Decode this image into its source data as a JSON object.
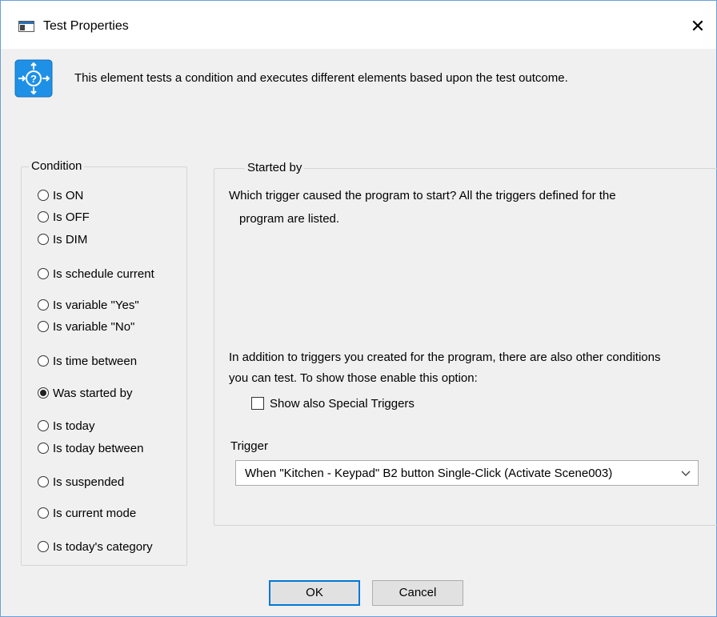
{
  "window": {
    "title": "Test Properties",
    "close_glyph": "✕"
  },
  "description": "This element tests a condition and executes different elements based upon the test outcome.",
  "condition": {
    "legend": "Condition",
    "options": [
      {
        "label": "Is ON",
        "checked": false
      },
      {
        "label": "Is OFF",
        "checked": false
      },
      {
        "label": "Is DIM",
        "checked": false
      },
      {
        "label": "Is schedule current",
        "checked": false
      },
      {
        "label": "Is variable \"Yes\"",
        "checked": false
      },
      {
        "label": "Is variable \"No\"",
        "checked": false
      },
      {
        "label": "Is time between",
        "checked": false
      },
      {
        "label": "Was started by",
        "checked": true
      },
      {
        "label": "Is today",
        "checked": false
      },
      {
        "label": "Is today between",
        "checked": false
      },
      {
        "label": "Is suspended",
        "checked": false
      },
      {
        "label": "Is current mode",
        "checked": false
      },
      {
        "label": "Is today's category",
        "checked": false
      }
    ]
  },
  "started_by": {
    "legend": "Started by",
    "question_line1": "Which trigger caused the program to start?  All the triggers defined for the",
    "question_line2": "program are listed.",
    "info_line1": "In addition to triggers you created for the program, there are also other conditions",
    "info_line2": "you can test.  To show those enable this option:",
    "special_checkbox_label": "Show also Special Triggers",
    "special_checked": false,
    "trigger_label": "Trigger",
    "trigger_value": "When \"Kitchen - Keypad\" B2 button Single-Click (Activate Scene003)"
  },
  "buttons": {
    "ok": "OK",
    "cancel": "Cancel"
  },
  "colors": {
    "accent": "#0078d7",
    "icon_blue": "#1e90e6",
    "window_border": "#6b9fd8"
  }
}
